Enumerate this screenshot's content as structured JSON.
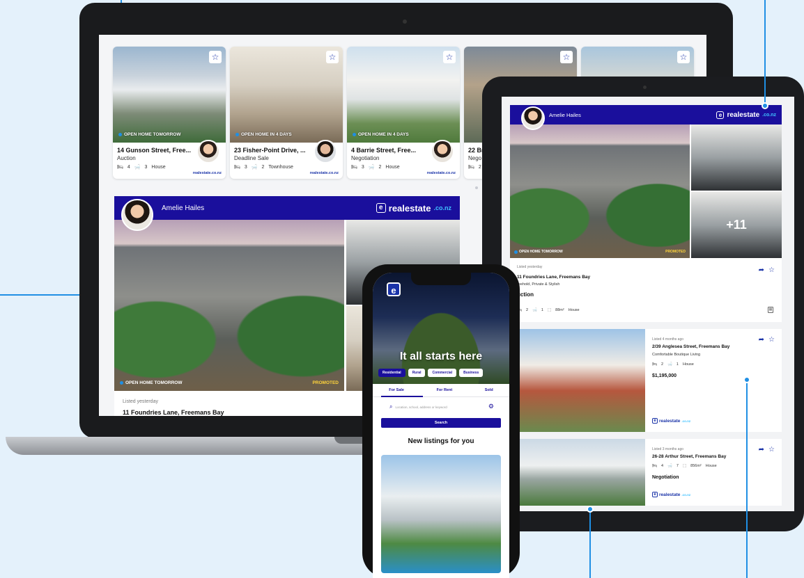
{
  "laptop": {
    "cards": [
      {
        "badge": "OPEN HOME TOMORROW",
        "title": "14 Gunson Street, Free...",
        "sale": "Auction",
        "beds": "4",
        "baths": "3",
        "type": "House",
        "logo": "realestate.co.nz"
      },
      {
        "badge": "OPEN HOME IN 4 DAYS",
        "title": "23 Fisher-Point Drive, ...",
        "sale": "Deadline Sale",
        "beds": "3",
        "baths": "2",
        "type": "Townhouse",
        "logo": "realestate.co.nz"
      },
      {
        "badge": "OPEN HOME IN 4 DAYS",
        "title": "4 Barrie Street, Free...",
        "sale": "Negotiation",
        "beds": "3",
        "baths": "2",
        "type": "House",
        "logo": "realestate.co.nz"
      },
      {
        "badge": "",
        "title": "22 Br",
        "sale": "Nego",
        "beds": "2",
        "baths": "",
        "type": "",
        "logo": ""
      },
      {
        "badge": "",
        "title": "",
        "sale": "",
        "beds": "",
        "baths": "",
        "type": "",
        "logo": ""
      }
    ],
    "promo": {
      "agent": "Amelie Hailes",
      "logo_name": "realestate",
      "logo_tld": ".co.nz",
      "logo_glyph": "e",
      "badge": "OPEN HOME TOMORROW",
      "promoted": "PROMOTED",
      "listed": "Listed yesterday",
      "address": "11 Foundries Lane, Freemans Bay"
    },
    "carousel": {
      "count": 6,
      "active": 3
    }
  },
  "tablet": {
    "promo": {
      "agent": "Amelie Hailes",
      "logo_name": "realestate",
      "logo_tld": ".co.nz",
      "logo_glyph": "e",
      "badge": "OPEN HOME TOMORROW",
      "promoted": "PROMOTED",
      "more_photos": "+11",
      "listed": "Listed yesterday",
      "address": "11 Foundries Lane, Freemans Bay",
      "subtitle": "reehold, Private & Stylish",
      "sale": "uction",
      "beds": "2",
      "baths": "1",
      "area": "88m²",
      "type": "House"
    },
    "listing2": {
      "listed": "Listed 4 months ago",
      "address": "2/39 Anglesea Street, Freemans Bay",
      "subtitle": "Comfortable Boutique Living",
      "beds": "2",
      "baths": "1",
      "type": "House",
      "price": "$1,195,000",
      "logo_name": "realestate",
      "logo_tld": ".co.nz"
    },
    "listing3": {
      "listed": "Listed 3 months ago",
      "address": "26-28 Arthur Street, Freemans Bay",
      "beds": "4",
      "baths": "7",
      "area": "856m²",
      "type": "House",
      "sale": "Negotiation",
      "logo_name": "realestate",
      "logo_tld": ".co.nz"
    }
  },
  "phone": {
    "hero_title": "It all starts here",
    "segments": [
      "Residential",
      "Rural",
      "Commercial",
      "Business"
    ],
    "tabs": [
      "For Sale",
      "For Rent",
      "Sold"
    ],
    "search_placeholder": "Location, school, address or keyword",
    "search_button": "Search",
    "section_title": "New listings for you"
  },
  "colors": {
    "brand_navy": "#1a0f9c",
    "accent_blue": "#1f8fe4",
    "tld_cyan": "#3ec1ff",
    "promoted_yellow": "#ffd43b",
    "background": "#e4f1fb"
  },
  "icons": [
    "star-icon",
    "share-icon",
    "bed-icon",
    "bath-icon",
    "land-area-icon",
    "search-icon",
    "filter-icon",
    "calculator-icon"
  ]
}
